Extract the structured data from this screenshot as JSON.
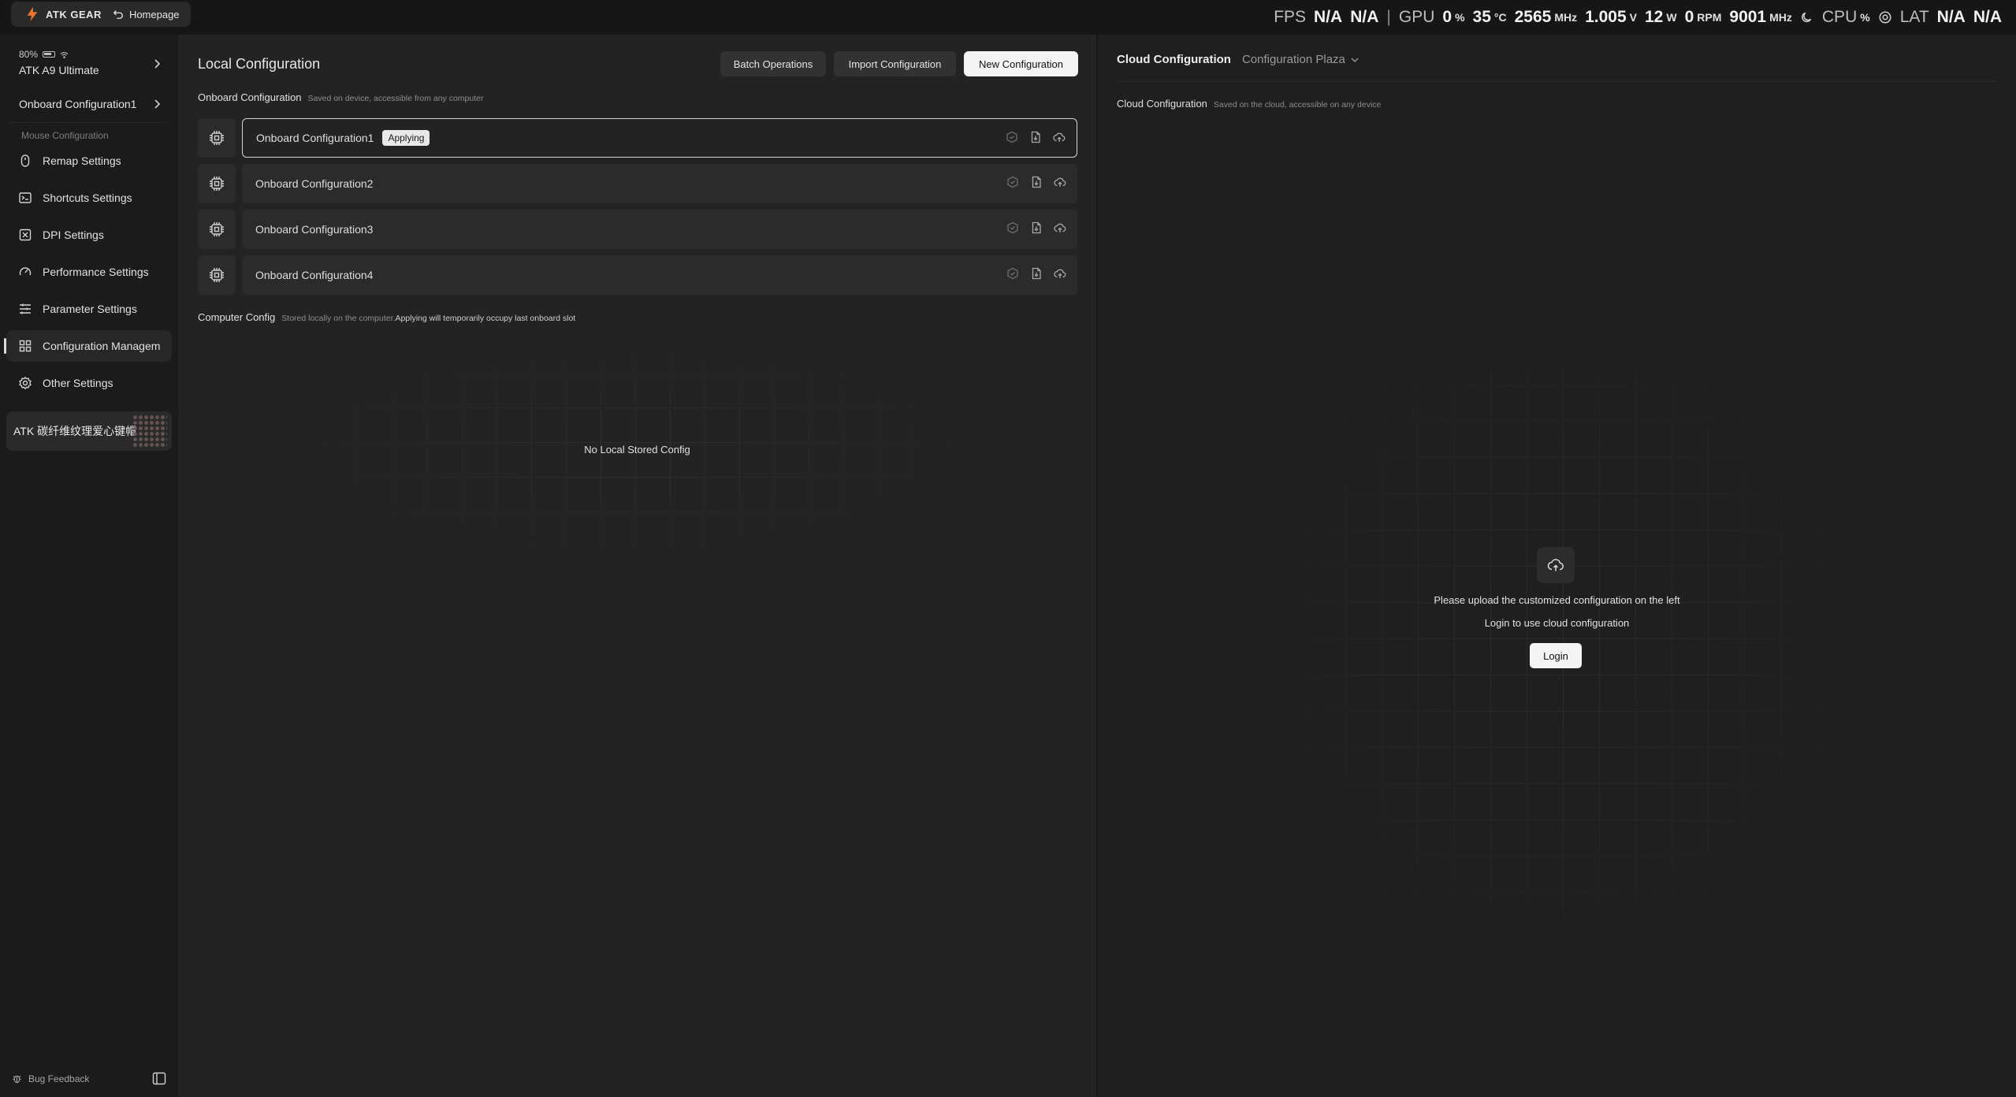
{
  "topbar": {
    "brand": "ATK GEAR",
    "home_label": "Homepage"
  },
  "overlay": {
    "fps_label": "FPS",
    "fps_val1": "N/A",
    "fps_val2": "N/A",
    "sep": "|",
    "gpu_label": "GPU",
    "gpu_usage": "0",
    "gpu_usage_unit": "%",
    "gpu_temp": "35",
    "gpu_temp_unit": "°C",
    "gpu_clock": "2565",
    "gpu_clock_unit": "MHz",
    "gpu_voltage": "1.005",
    "gpu_voltage_unit": "V",
    "gpu_power": "12",
    "gpu_power_unit": "W",
    "fan": "0",
    "fan_unit": "RPM",
    "mem_clock": "9001",
    "mem_clock_unit": "MHz",
    "cpu_label": "CPU",
    "cpu_usage_unit": "%",
    "lat_label": "LAT",
    "lat_val1": "N/A",
    "lat_val2": "N/A"
  },
  "sidebar": {
    "device_battery": "80%",
    "device_name": "ATK A9 Ultimate",
    "current_config": "Onboard Configuration1",
    "section_label": "Mouse Configuration",
    "items": [
      {
        "label": "Remap Settings",
        "icon": "mouse-icon"
      },
      {
        "label": "Shortcuts Settings",
        "icon": "terminal-icon"
      },
      {
        "label": "DPI Settings",
        "icon": "dpi-icon"
      },
      {
        "label": "Performance Settings",
        "icon": "gauge-icon"
      },
      {
        "label": "Parameter Settings",
        "icon": "sliders-icon"
      },
      {
        "label": "Configuration Managem",
        "icon": "grid-icon",
        "active": true
      },
      {
        "label": "Other Settings",
        "icon": "gear-icon"
      }
    ],
    "promo": "ATK 碳纤维纹理爱心键帽",
    "bug_feedback": "Bug Feedback"
  },
  "local": {
    "title": "Local Configuration",
    "buttons": {
      "batch": "Batch Operations",
      "import": "Import Configuration",
      "new": "New Configuration"
    },
    "onboard_title": "Onboard Configuration",
    "onboard_hint": "Saved on device, accessible from any computer",
    "slots": [
      {
        "name": "Onboard Configuration1",
        "badge": "Applying"
      },
      {
        "name": "Onboard Configuration2"
      },
      {
        "name": "Onboard Configuration3"
      },
      {
        "name": "Onboard Configuration4"
      }
    ],
    "computer_title": "Computer Config",
    "computer_hint": "Stored locally on the computer.",
    "computer_hint_strong": "Applying will temporarily occupy last onboard slot",
    "empty": "No Local Stored Config"
  },
  "cloud": {
    "tab_active": "Cloud Configuration",
    "tab_plaza": "Configuration Plaza",
    "section_title": "Cloud Configuration",
    "section_hint": "Saved on the cloud, accessible on any device",
    "msg1": "Please upload the customized configuration on the left",
    "msg2": "Login to use cloud configuration",
    "login": "Login"
  }
}
